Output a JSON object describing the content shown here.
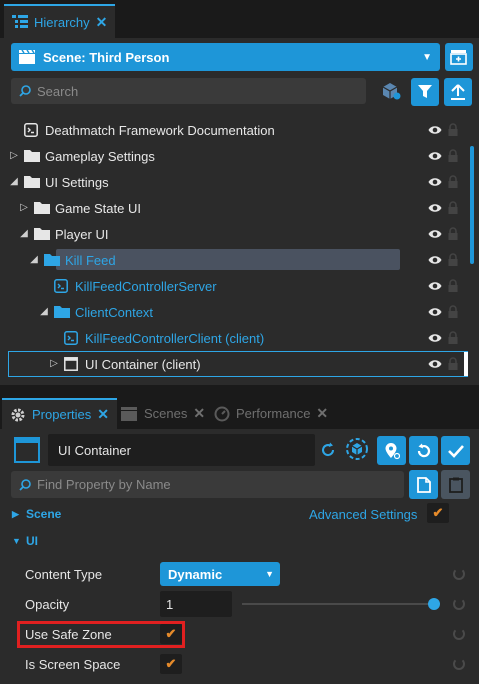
{
  "hierarchy": {
    "tab_label": "Hierarchy",
    "scene_label": "Scene: Third Person",
    "search_placeholder": "Search",
    "items": [
      {
        "label": "Deathmatch Framework Documentation",
        "indent": 0,
        "arrow": "",
        "icon": "script-icon",
        "blue": false,
        "selected": false
      },
      {
        "label": "Gameplay Settings",
        "indent": 0,
        "arrow": "collapsed",
        "icon": "folder-icon",
        "blue": false,
        "selected": false
      },
      {
        "label": "UI Settings",
        "indent": 0,
        "arrow": "expanded",
        "icon": "folder-icon",
        "blue": false,
        "selected": false
      },
      {
        "label": "Game State UI",
        "indent": 1,
        "arrow": "collapsed",
        "icon": "folder-icon",
        "blue": false,
        "selected": false
      },
      {
        "label": "Player UI",
        "indent": 1,
        "arrow": "expanded",
        "icon": "folder-icon",
        "blue": false,
        "selected": false
      },
      {
        "label": "Kill Feed",
        "indent": 2,
        "arrow": "expanded",
        "icon": "folder-icon",
        "blue": true,
        "selected": true
      },
      {
        "label": "KillFeedControllerServer",
        "indent": 3,
        "arrow": "",
        "icon": "script-icon",
        "blue": true,
        "selected": false
      },
      {
        "label": "ClientContext",
        "indent": 3,
        "arrow": "expanded",
        "icon": "folder-icon",
        "blue": true,
        "selected": false
      },
      {
        "label": "KillFeedControllerClient (client)",
        "indent": 4,
        "arrow": "",
        "icon": "script-icon",
        "blue": true,
        "selected": false
      },
      {
        "label": "UI Container (client)",
        "indent": 4,
        "arrow": "collapsed",
        "icon": "container-icon",
        "blue": false,
        "selected": false,
        "outlined": true
      }
    ]
  },
  "properties": {
    "tabs": [
      "Properties",
      "Scenes",
      "Performance"
    ],
    "name_value": "UI Container",
    "find_placeholder": "Find Property by Name",
    "scene_section": "Scene",
    "advanced_settings": "Advanced Settings",
    "ui_section": "UI",
    "content_type_label": "Content Type",
    "content_type_value": "Dynamic",
    "opacity_label": "Opacity",
    "opacity_value": "1",
    "opacity_fraction": 1.0,
    "safe_zone_label": "Use Safe Zone",
    "screen_space_label": "Is Screen Space"
  },
  "colors": {
    "accent": "#1e96d8",
    "check": "#e58a2a",
    "highlight": "#e02020"
  }
}
